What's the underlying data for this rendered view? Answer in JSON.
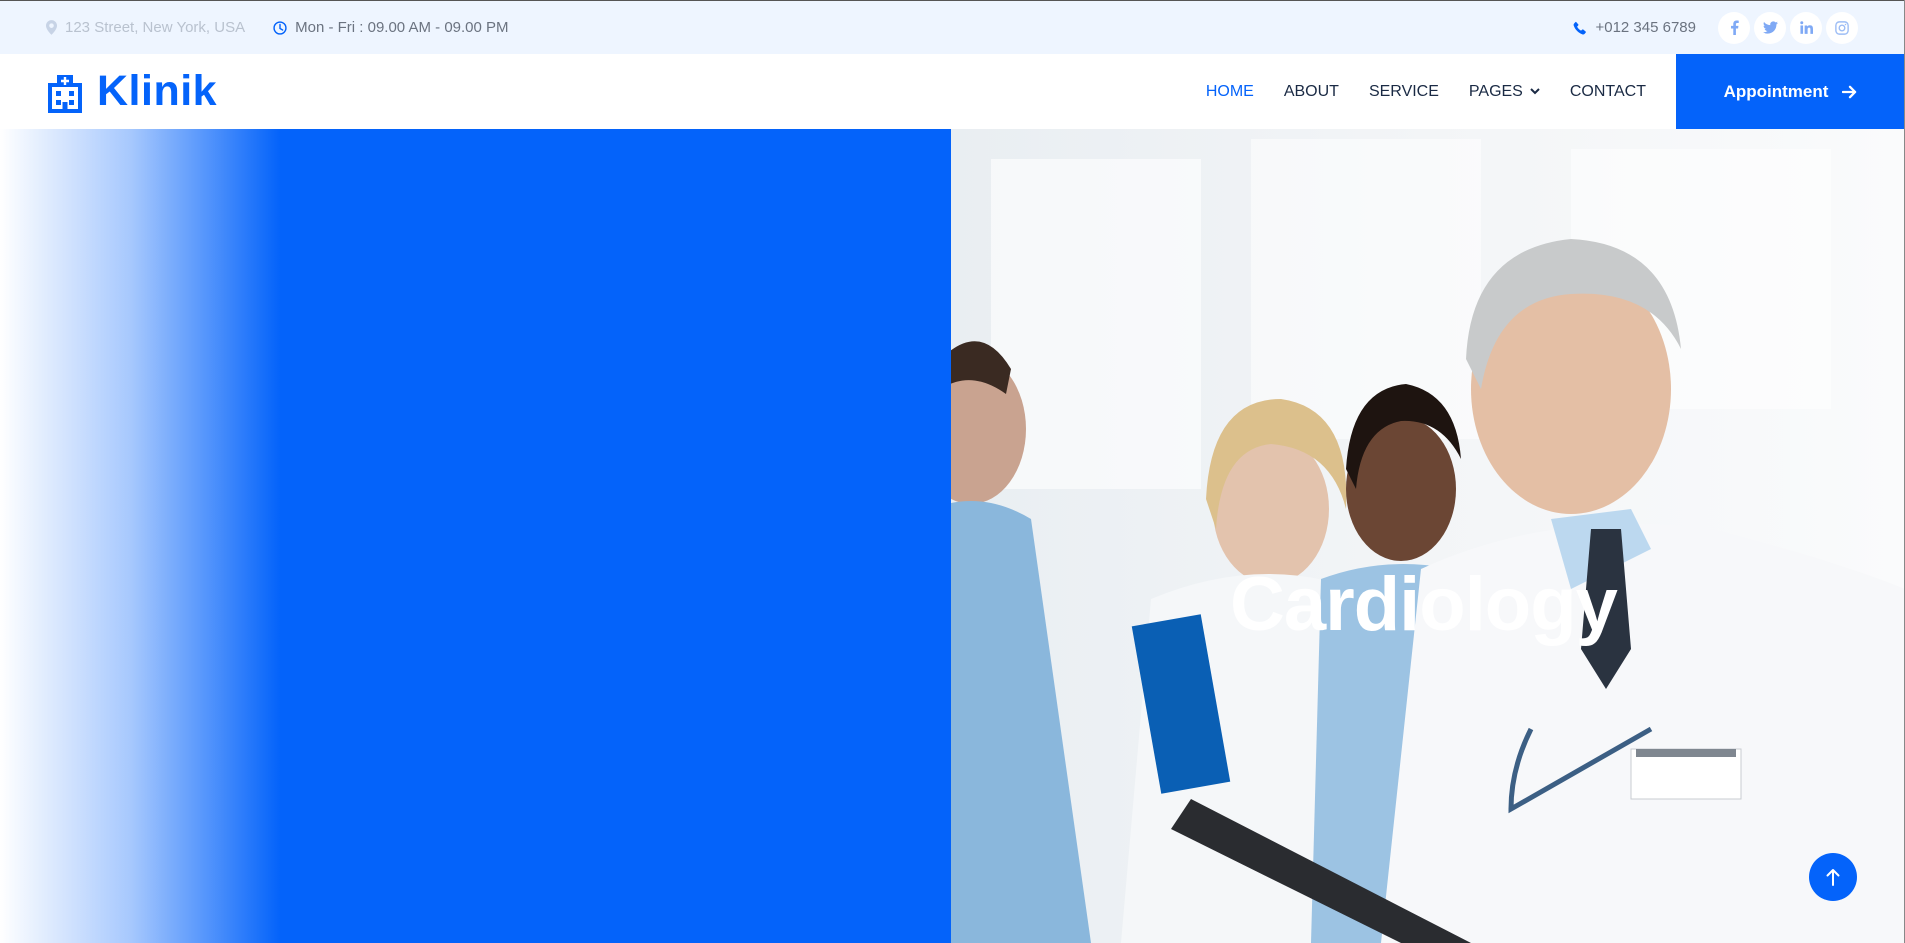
{
  "topbar": {
    "address": "123 Street, New York, USA",
    "hours": "Mon - Fri : 09.00 AM - 09.00 PM",
    "phone": "+012 345 6789",
    "social": [
      {
        "icon": "facebook-icon"
      },
      {
        "icon": "twitter-icon"
      },
      {
        "icon": "linkedin-icon"
      },
      {
        "icon": "instagram-icon"
      }
    ]
  },
  "navbar": {
    "brand": "Klinik",
    "links": [
      "HOME",
      "ABOUT",
      "SERVICE",
      "PAGES",
      "CONTACT"
    ],
    "active": "HOME",
    "appointment_label": "Appointment"
  },
  "hero": {
    "title": "Cardiology"
  },
  "colors": {
    "primary": "#0463FA",
    "topbar_bg": "#EEF5FF",
    "text_dark": "#1a2a44"
  }
}
